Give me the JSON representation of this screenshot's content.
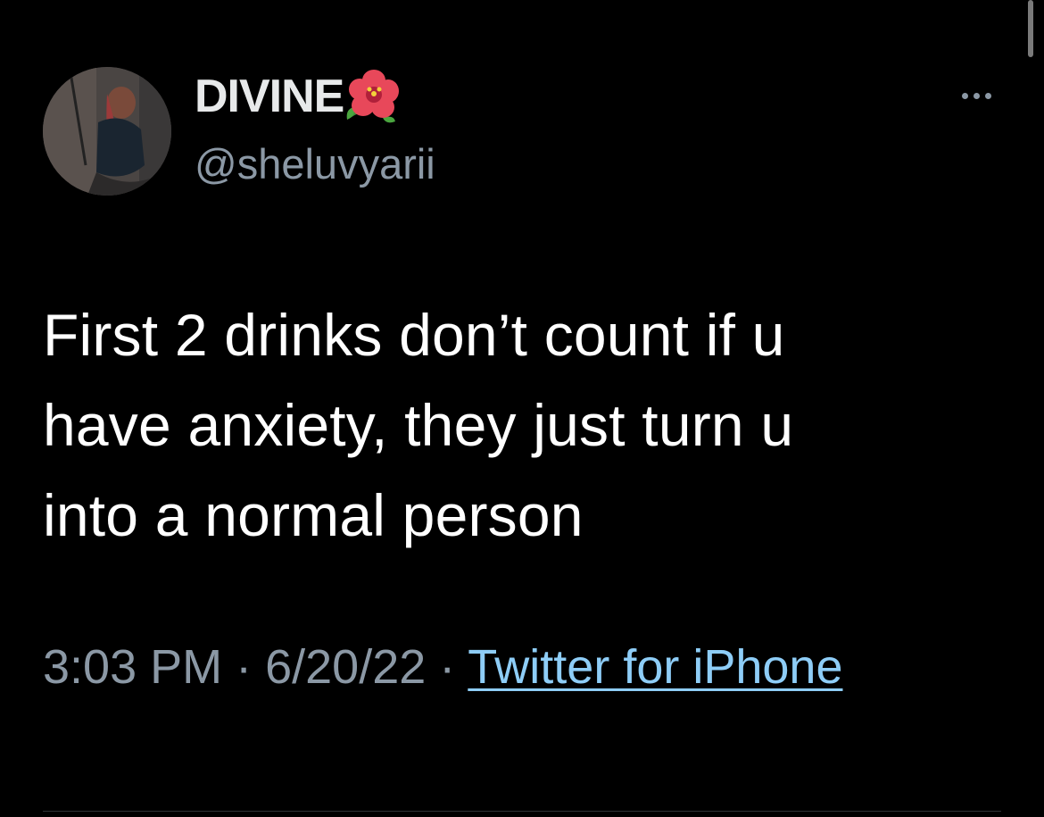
{
  "tweet": {
    "author": {
      "display_name": "DIVINE",
      "name_emoji": "hibiscus-icon",
      "handle": "@sheluvyarii"
    },
    "text_lines": [
      "First 2 drinks don’t count if u",
      "have anxiety, they just turn u",
      "into a normal person"
    ],
    "time": "3:03 PM",
    "separator": " · ",
    "date": "6/20/22",
    "source": "Twitter for iPhone"
  },
  "colors": {
    "background": "#000000",
    "primary_text": "#e7e9ea",
    "secondary_text": "#8b98a5",
    "link": "#8ecdf7"
  }
}
